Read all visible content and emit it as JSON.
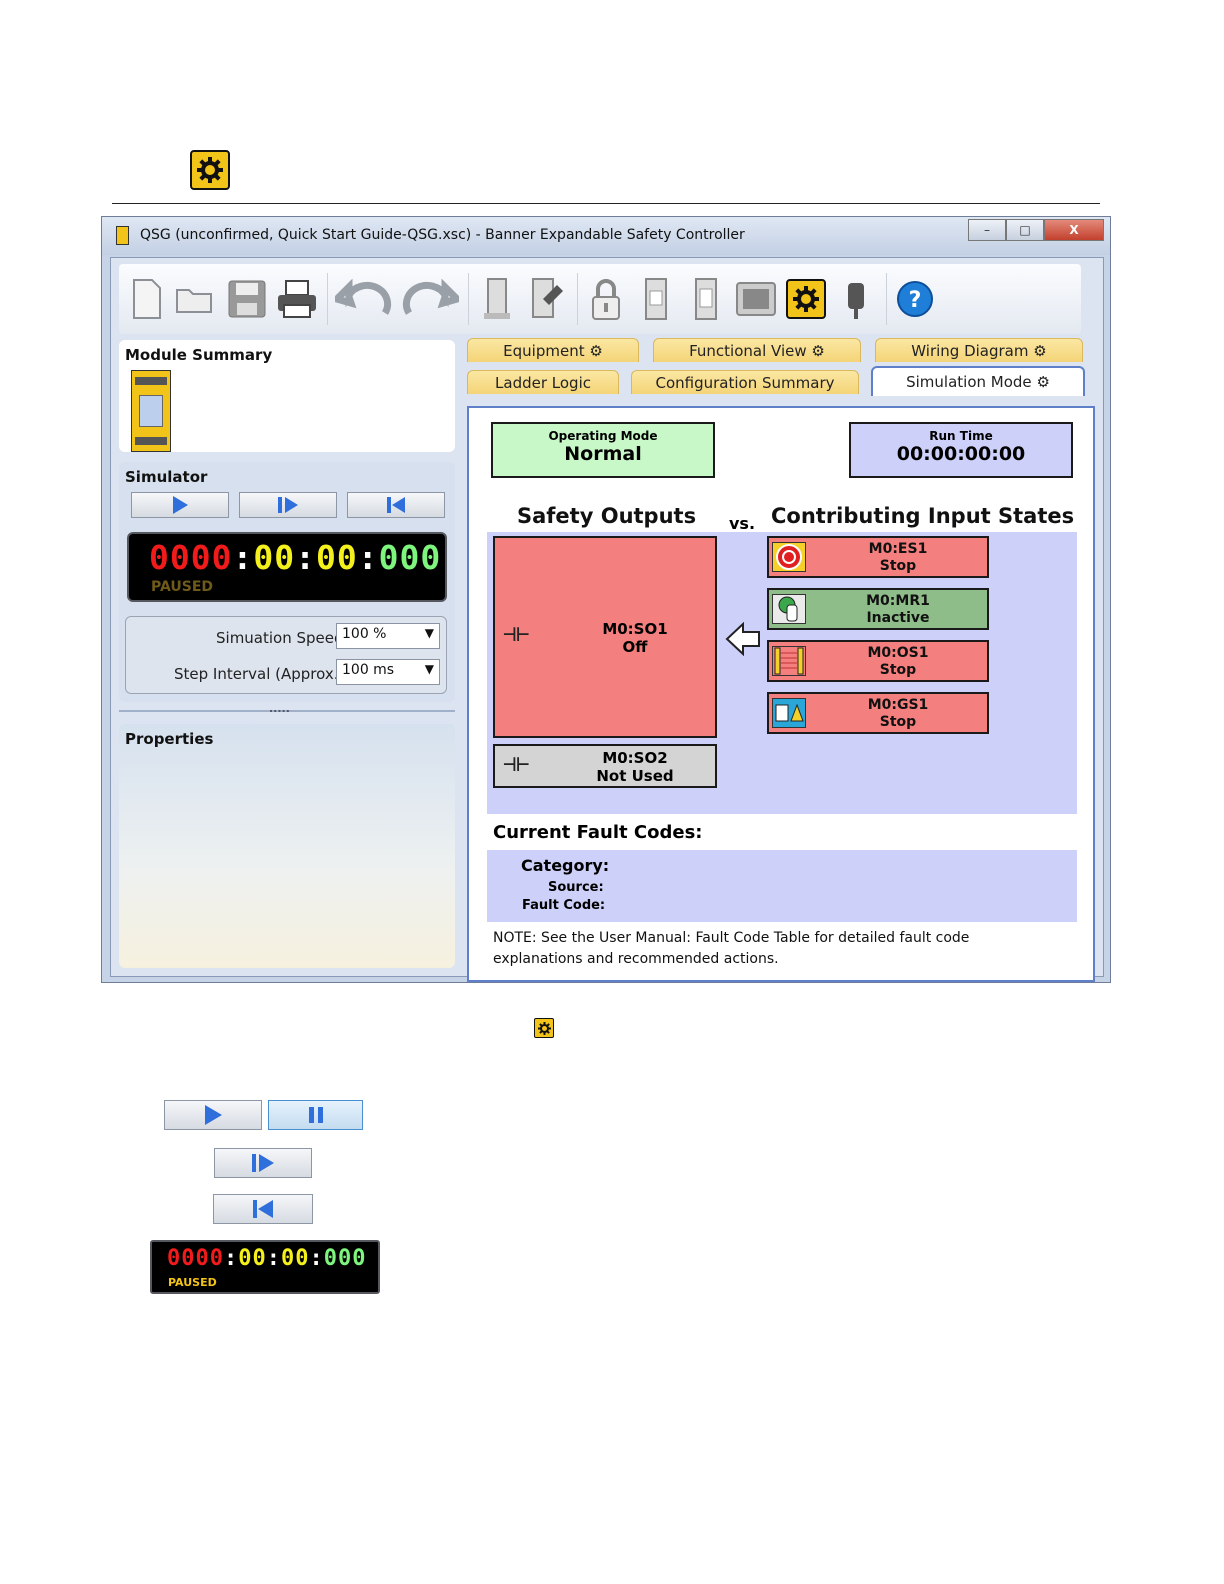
{
  "window": {
    "title": "QSG (unconfirmed, Quick Start Guide-QSG.xsc) - Banner Expandable Safety Controller",
    "controls": {
      "minimize": "–",
      "maximize": "□",
      "close": "X"
    }
  },
  "toolbar": {
    "icons": [
      "new-icon",
      "open-icon",
      "save-icon",
      "print-icon",
      "undo-icon",
      "redo-icon",
      "module-icon",
      "inspect-icon",
      "lock-icon",
      "io-module-icon",
      "relay-module-icon",
      "display-icon",
      "simulation-gear-icon",
      "probe-icon",
      "help-icon"
    ]
  },
  "left": {
    "module_summary": "Module Summary",
    "simulator": "Simulator",
    "clock": {
      "red": "0000",
      "yellow1": "00",
      "yellow2": "00",
      "green": "000",
      "sep": ":",
      "status": "PAUSED"
    },
    "settings": {
      "speed_label": "Simuation Speed",
      "speed_value": "100 %",
      "interval_label": "Step Interval (Approx.)",
      "interval_value": "100 ms"
    },
    "splitter": ".....",
    "properties": "Properties"
  },
  "tabs": {
    "row1": [
      "Equipment",
      "Functional View",
      "Wiring Diagram"
    ],
    "row2": [
      "Ladder Logic",
      "Configuration Summary",
      "Simulation Mode"
    ]
  },
  "sim": {
    "operating_mode_label": "Operating Mode",
    "operating_mode_value": "Normal",
    "run_time_label": "Run Time",
    "run_time_value": "00:00:00:00",
    "safety_outputs": "Safety Outputs",
    "vs": "vs.",
    "contributing": "Contributing Input States",
    "outputs": [
      {
        "name": "M0:SO1",
        "state": "Off"
      },
      {
        "name": "M0:SO2",
        "state": "Not Used"
      }
    ],
    "inputs": [
      {
        "name": "M0:ES1",
        "state": "Stop"
      },
      {
        "name": "M0:MR1",
        "state": "Inactive"
      },
      {
        "name": "M0:OS1",
        "state": "Stop"
      },
      {
        "name": "M0:GS1",
        "state": "Stop"
      }
    ],
    "fault_heading": "Current Fault Codes:",
    "category": "Category:",
    "source": "Source:",
    "fault_code": "Fault Code:",
    "note": "NOTE: See the User Manual: Fault Code Table for detailed fault code explanations and recommended actions."
  },
  "legend": {
    "clock": {
      "red": "0000",
      "yellow1": "00",
      "yellow2": "00",
      "green": "000",
      "sep": ":",
      "status": "PAUSED"
    }
  },
  "colors": {
    "gear_yellow": "#f2c318",
    "output_off": "#f47f7f",
    "input_inactive": "#8fbd8a",
    "not_used": "#d4d4d4",
    "mode_green": "#c8f8c8",
    "lavender": "#cdd0f8",
    "tab_gold": "#f4d478"
  }
}
